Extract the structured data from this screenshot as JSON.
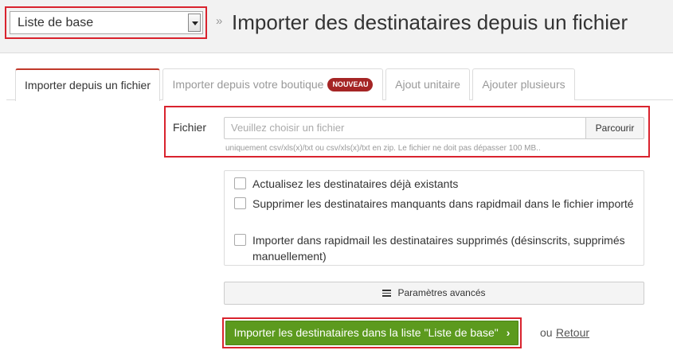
{
  "header": {
    "list_select_value": "Liste de base",
    "separator": "»",
    "title": "Importer des destinataires depuis un fichier"
  },
  "tabs": [
    {
      "label": "Importer depuis un fichier",
      "active": true
    },
    {
      "label": "Importer depuis votre boutique",
      "badge": "NOUVEAU",
      "active": false
    },
    {
      "label": "Ajout unitaire",
      "active": false
    },
    {
      "label": "Ajouter plusieurs",
      "active": false
    }
  ],
  "file": {
    "label": "Fichier",
    "placeholder": "Veuillez choisir un fichier",
    "browse_label": "Parcourir",
    "help": "uniquement csv/xls(x)/txt ou csv/xls(x)/txt en zip. Le fichier ne doit pas dépasser 100 MB.."
  },
  "options": [
    {
      "label": "Actualisez les destinataires déjà existants",
      "checked": false
    },
    {
      "label": "Supprimer les destinataires manquants dans rapidmail dans le fichier importé",
      "checked": false
    },
    {
      "label": "Importer dans rapidmail les destinataires supprimés (désinscrits, supprimés manuellement)",
      "checked": false
    }
  ],
  "advanced_label": "Paramètres avancés",
  "submit_label": "Importer les destinataires dans la liste \"Liste de base\"",
  "submit_chevron": "›",
  "or_text": "ou",
  "back_label": "Retour",
  "colors": {
    "highlight": "#d9232e",
    "submit": "#5c9a1e",
    "badge": "#a52525"
  }
}
